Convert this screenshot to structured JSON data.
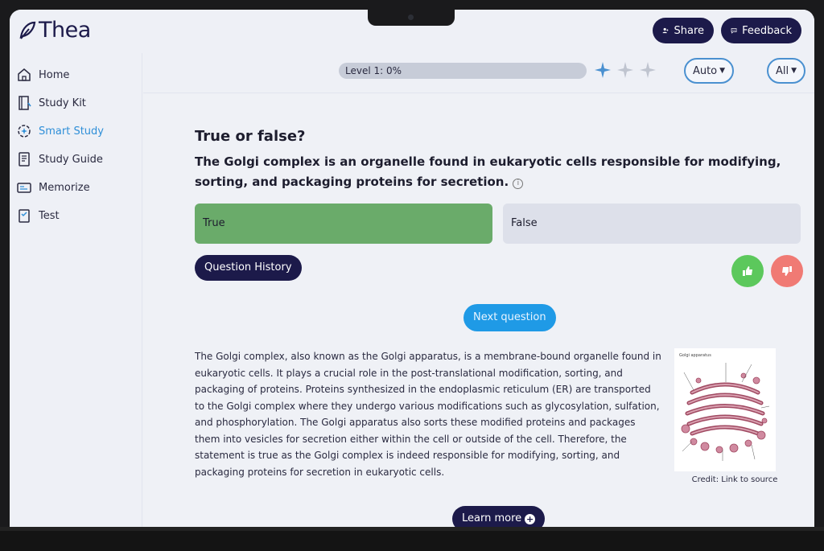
{
  "app": {
    "name": "Thea"
  },
  "header": {
    "share_label": "Share",
    "feedback_label": "Feedback"
  },
  "sidebar": {
    "items": [
      {
        "label": "Home",
        "icon": "home-icon"
      },
      {
        "label": "Study Kit",
        "icon": "book-icon"
      },
      {
        "label": "Smart Study",
        "icon": "brain-icon",
        "active": true
      },
      {
        "label": "Study Guide",
        "icon": "guide-icon"
      },
      {
        "label": "Memorize",
        "icon": "cards-icon"
      },
      {
        "label": "Test",
        "icon": "test-icon"
      }
    ]
  },
  "topbar": {
    "progress_label": "Level 1: 0%",
    "progress": 0,
    "mode_select": "Auto",
    "filter_select": "All"
  },
  "question": {
    "type": "True or false?",
    "text": "The Golgi complex is an organelle found in eukaryotic cells responsible for modifying, sorting, and packaging proteins for secretion.",
    "options": [
      "True",
      "False"
    ],
    "selected": "True"
  },
  "buttons": {
    "question_history": "Question History",
    "next_question": "Next question",
    "learn_more": "Learn more"
  },
  "explanation": "The Golgi complex, also known as the Golgi apparatus, is a membrane-bound organelle found in eukaryotic cells. It plays a crucial role in the post-translational modification, sorting, and packaging of proteins. Proteins synthesized in the endoplasmic reticulum (ER) are transported to the Golgi complex where they undergo various modifications such as glycosylation, sulfation, and phosphorylation. The Golgi apparatus also sorts these modified proteins and packages them into vesicles for secretion either within the cell or outside of the cell. Therefore, the statement is true as the Golgi complex is indeed responsible for modifying, sorting, and packaging proteins for secretion in eukaryotic cells.",
  "image": {
    "credit": "Credit: Link to source",
    "title": "Golgi apparatus"
  },
  "colors": {
    "brand": "#1c1a4a",
    "accent": "#1f9ae6",
    "correct": "#6aab6a"
  }
}
